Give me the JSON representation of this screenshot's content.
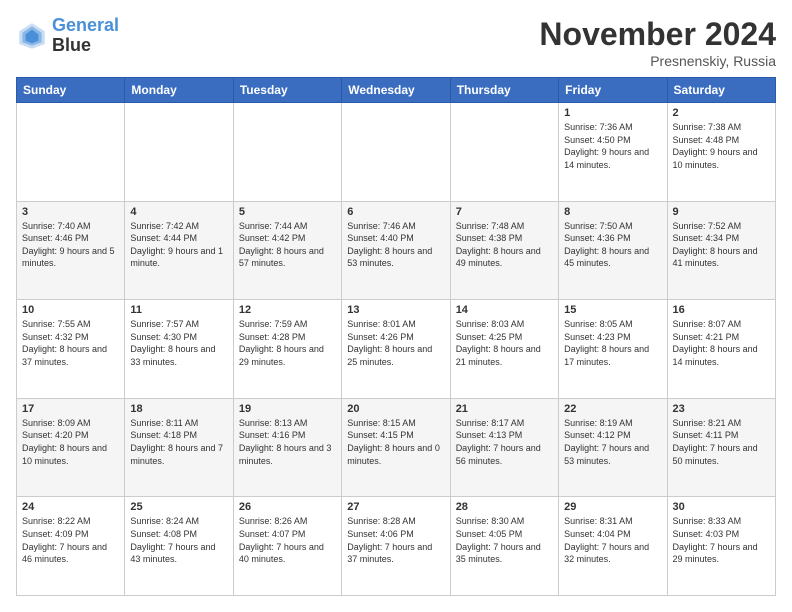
{
  "logo": {
    "line1": "General",
    "line2": "Blue"
  },
  "title": "November 2024",
  "subtitle": "Presnenskiy, Russia",
  "days_header": [
    "Sunday",
    "Monday",
    "Tuesday",
    "Wednesday",
    "Thursday",
    "Friday",
    "Saturday"
  ],
  "weeks": [
    [
      {
        "day": "",
        "info": ""
      },
      {
        "day": "",
        "info": ""
      },
      {
        "day": "",
        "info": ""
      },
      {
        "day": "",
        "info": ""
      },
      {
        "day": "",
        "info": ""
      },
      {
        "day": "1",
        "info": "Sunrise: 7:36 AM\nSunset: 4:50 PM\nDaylight: 9 hours and 14 minutes."
      },
      {
        "day": "2",
        "info": "Sunrise: 7:38 AM\nSunset: 4:48 PM\nDaylight: 9 hours and 10 minutes."
      }
    ],
    [
      {
        "day": "3",
        "info": "Sunrise: 7:40 AM\nSunset: 4:46 PM\nDaylight: 9 hours and 5 minutes."
      },
      {
        "day": "4",
        "info": "Sunrise: 7:42 AM\nSunset: 4:44 PM\nDaylight: 9 hours and 1 minute."
      },
      {
        "day": "5",
        "info": "Sunrise: 7:44 AM\nSunset: 4:42 PM\nDaylight: 8 hours and 57 minutes."
      },
      {
        "day": "6",
        "info": "Sunrise: 7:46 AM\nSunset: 4:40 PM\nDaylight: 8 hours and 53 minutes."
      },
      {
        "day": "7",
        "info": "Sunrise: 7:48 AM\nSunset: 4:38 PM\nDaylight: 8 hours and 49 minutes."
      },
      {
        "day": "8",
        "info": "Sunrise: 7:50 AM\nSunset: 4:36 PM\nDaylight: 8 hours and 45 minutes."
      },
      {
        "day": "9",
        "info": "Sunrise: 7:52 AM\nSunset: 4:34 PM\nDaylight: 8 hours and 41 minutes."
      }
    ],
    [
      {
        "day": "10",
        "info": "Sunrise: 7:55 AM\nSunset: 4:32 PM\nDaylight: 8 hours and 37 minutes."
      },
      {
        "day": "11",
        "info": "Sunrise: 7:57 AM\nSunset: 4:30 PM\nDaylight: 8 hours and 33 minutes."
      },
      {
        "day": "12",
        "info": "Sunrise: 7:59 AM\nSunset: 4:28 PM\nDaylight: 8 hours and 29 minutes."
      },
      {
        "day": "13",
        "info": "Sunrise: 8:01 AM\nSunset: 4:26 PM\nDaylight: 8 hours and 25 minutes."
      },
      {
        "day": "14",
        "info": "Sunrise: 8:03 AM\nSunset: 4:25 PM\nDaylight: 8 hours and 21 minutes."
      },
      {
        "day": "15",
        "info": "Sunrise: 8:05 AM\nSunset: 4:23 PM\nDaylight: 8 hours and 17 minutes."
      },
      {
        "day": "16",
        "info": "Sunrise: 8:07 AM\nSunset: 4:21 PM\nDaylight: 8 hours and 14 minutes."
      }
    ],
    [
      {
        "day": "17",
        "info": "Sunrise: 8:09 AM\nSunset: 4:20 PM\nDaylight: 8 hours and 10 minutes."
      },
      {
        "day": "18",
        "info": "Sunrise: 8:11 AM\nSunset: 4:18 PM\nDaylight: 8 hours and 7 minutes."
      },
      {
        "day": "19",
        "info": "Sunrise: 8:13 AM\nSunset: 4:16 PM\nDaylight: 8 hours and 3 minutes."
      },
      {
        "day": "20",
        "info": "Sunrise: 8:15 AM\nSunset: 4:15 PM\nDaylight: 8 hours and 0 minutes."
      },
      {
        "day": "21",
        "info": "Sunrise: 8:17 AM\nSunset: 4:13 PM\nDaylight: 7 hours and 56 minutes."
      },
      {
        "day": "22",
        "info": "Sunrise: 8:19 AM\nSunset: 4:12 PM\nDaylight: 7 hours and 53 minutes."
      },
      {
        "day": "23",
        "info": "Sunrise: 8:21 AM\nSunset: 4:11 PM\nDaylight: 7 hours and 50 minutes."
      }
    ],
    [
      {
        "day": "24",
        "info": "Sunrise: 8:22 AM\nSunset: 4:09 PM\nDaylight: 7 hours and 46 minutes."
      },
      {
        "day": "25",
        "info": "Sunrise: 8:24 AM\nSunset: 4:08 PM\nDaylight: 7 hours and 43 minutes."
      },
      {
        "day": "26",
        "info": "Sunrise: 8:26 AM\nSunset: 4:07 PM\nDaylight: 7 hours and 40 minutes."
      },
      {
        "day": "27",
        "info": "Sunrise: 8:28 AM\nSunset: 4:06 PM\nDaylight: 7 hours and 37 minutes."
      },
      {
        "day": "28",
        "info": "Sunrise: 8:30 AM\nSunset: 4:05 PM\nDaylight: 7 hours and 35 minutes."
      },
      {
        "day": "29",
        "info": "Sunrise: 8:31 AM\nSunset: 4:04 PM\nDaylight: 7 hours and 32 minutes."
      },
      {
        "day": "30",
        "info": "Sunrise: 8:33 AM\nSunset: 4:03 PM\nDaylight: 7 hours and 29 minutes."
      }
    ]
  ]
}
